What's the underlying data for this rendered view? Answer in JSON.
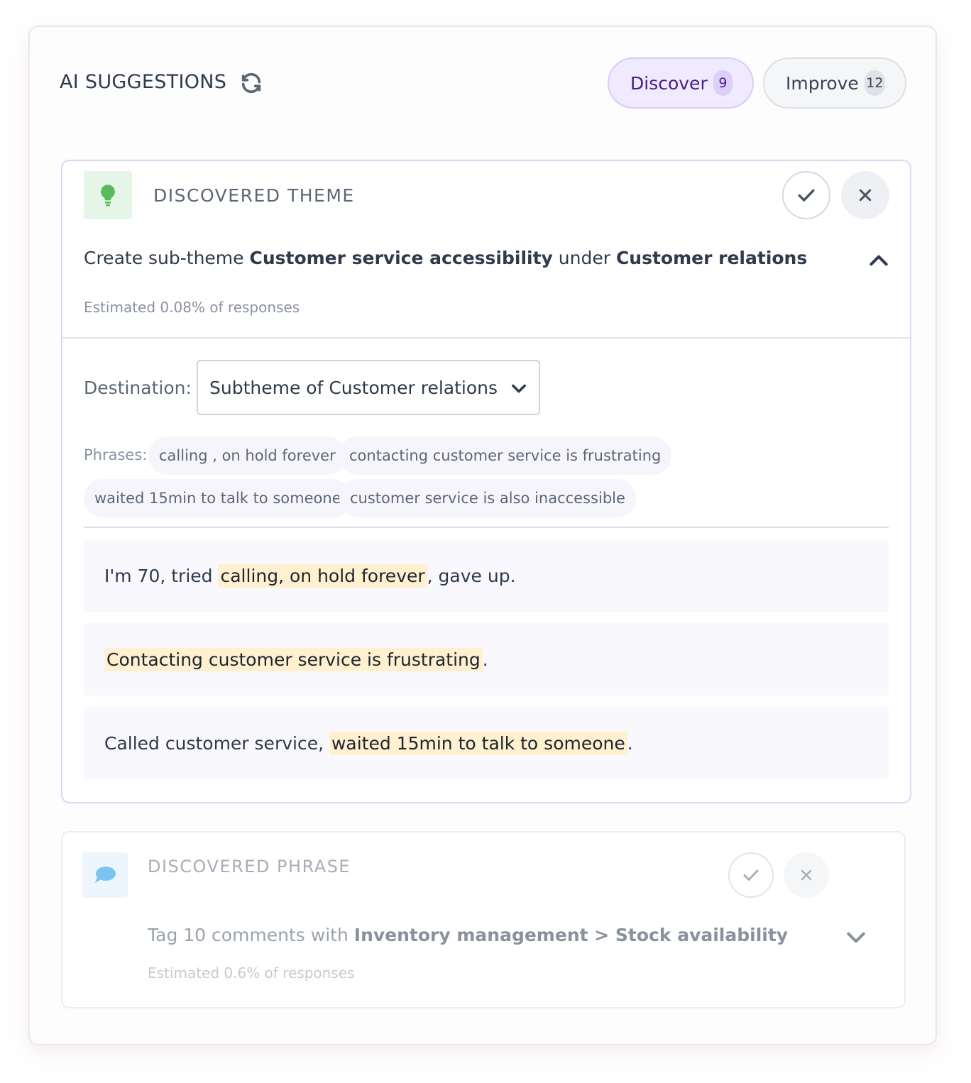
{
  "header": {
    "title": "AI SUGGESTIONS",
    "refresh_icon": "refresh-icon",
    "tabs": [
      {
        "label": "Discover",
        "count": "9",
        "active": true
      },
      {
        "label": "Improve",
        "count": "12",
        "active": false
      }
    ]
  },
  "theme_card": {
    "icon": "lightbulb-icon",
    "kind_label": "DISCOVERED THEME",
    "summary": {
      "prefix": "Create sub-theme ",
      "theme": "Customer service accessibility",
      "middle": " under ",
      "parent": "Customer relations"
    },
    "estimate": "Estimated 0.08% of responses",
    "destination_label": "Destination:",
    "destination_value": "Subtheme of Customer relations",
    "phrases_label": "Phrases:",
    "phrases": [
      "calling , on hold forever",
      "contacting customer service is frustrating",
      "waited 15min to talk to someone",
      "customer service is also inaccessible"
    ],
    "responses": [
      {
        "before": "I'm 70, tried ",
        "highlight": "calling, on hold forever",
        "after": ", gave up."
      },
      {
        "before": "",
        "highlight": "Contacting customer service is frustrating",
        "after": "."
      },
      {
        "before": "Called customer service, ",
        "highlight": "waited 15min to talk to someone",
        "after": "."
      }
    ]
  },
  "phrase_card": {
    "icon": "speech-bubble-icon",
    "kind_label": "DISCOVERED PHRASE",
    "summary": {
      "prefix": "Tag 10 comments with ",
      "target": "Inventory management > Stock availability"
    },
    "estimate": "Estimated 0.6% of responses"
  },
  "colors": {
    "accent_purple": "#4c1d86",
    "highlight": "#fff1cf",
    "theme_icon_green": "#5cb85c",
    "phrase_icon_blue": "#7cc3f2"
  }
}
